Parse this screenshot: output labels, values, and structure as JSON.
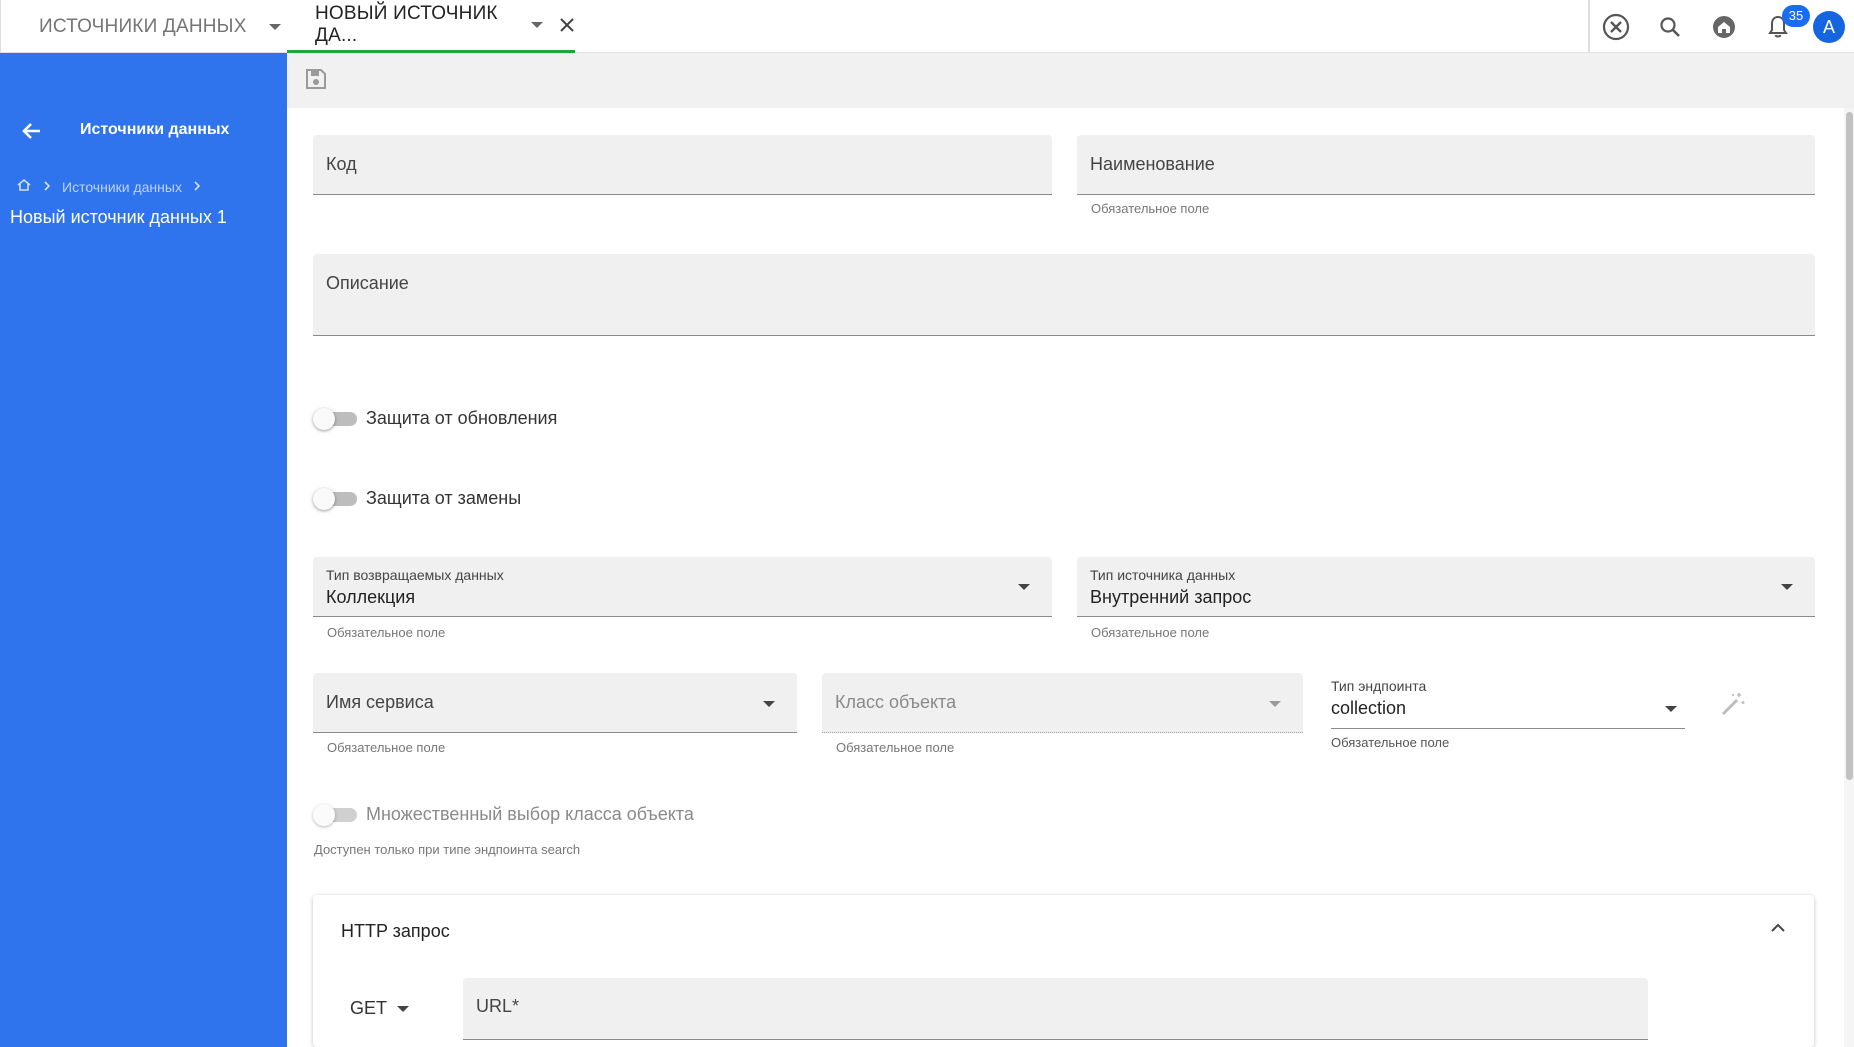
{
  "tabs": [
    {
      "label": "ИСТОЧНИКИ ДАННЫХ"
    },
    {
      "label": "НОВЫЙ ИСТОЧНИК ДА..."
    }
  ],
  "notifications": {
    "count": "35"
  },
  "user": {
    "initial": "A"
  },
  "sidebar": {
    "title": "Источники данных",
    "breadcrumb": "Источники данных",
    "current": "Новый источник данных 1"
  },
  "form": {
    "code": {
      "label": "Код"
    },
    "name": {
      "label": "Наименование",
      "hint": "Обязательное поле"
    },
    "description": {
      "label": "Описание"
    },
    "protect_update": {
      "label": "Защита от обновления"
    },
    "protect_replace": {
      "label": "Защита от замены"
    },
    "return_type": {
      "label": "Тип возвращаемых данных",
      "value": "Коллекция",
      "hint": "Обязательное поле"
    },
    "source_type": {
      "label": "Тип источника данных",
      "value": "Внутренний запрос",
      "hint": "Обязательное поле"
    },
    "service_name": {
      "label": "Имя сервиса",
      "hint": "Обязательное поле"
    },
    "object_class": {
      "label": "Класс объекта",
      "hint": "Обязательное поле"
    },
    "endpoint_type": {
      "label": "Тип эндпоинта",
      "value": "collection",
      "hint": "Обязательное поле"
    },
    "multi_select": {
      "label": "Множественный выбор класса объекта",
      "hint": "Доступен только при типе эндпоинта search"
    }
  },
  "http": {
    "title": "HTTP запрос",
    "method": "GET",
    "url_label": "URL*"
  },
  "colors": {
    "sidebar": "#2f74ec",
    "active_tab": "#22a33a",
    "badge": "#1a6cf0"
  }
}
